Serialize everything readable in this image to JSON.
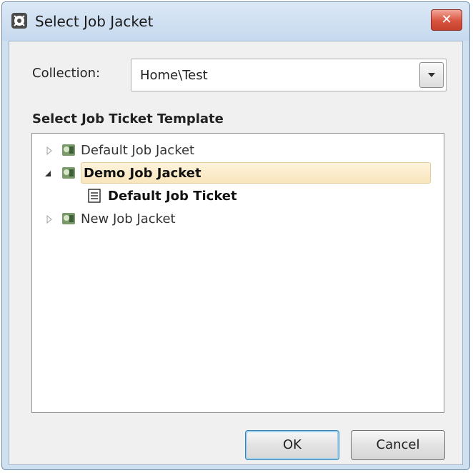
{
  "window": {
    "title": "Select Job Jacket",
    "close_label": "✕"
  },
  "collection": {
    "label": "Collection:",
    "value": "Home\\Test"
  },
  "template_section": {
    "heading": "Select Job Ticket Template"
  },
  "tree": {
    "items": [
      {
        "label": "Default Job Jacket",
        "expanded": false,
        "selected": false,
        "icon": "job-jacket-icon"
      },
      {
        "label": "Demo Job Jacket",
        "expanded": true,
        "selected": true,
        "icon": "job-jacket-icon"
      },
      {
        "label": "Default Job Ticket",
        "expanded": false,
        "selected": false,
        "icon": "job-ticket-icon"
      },
      {
        "label": "New Job Jacket",
        "expanded": false,
        "selected": false,
        "icon": "job-jacket-icon"
      }
    ]
  },
  "buttons": {
    "ok": "OK",
    "cancel": "Cancel"
  },
  "colors": {
    "titlebar": "#c6d9ee",
    "selection": "#f8e5bb",
    "close": "#d8543f",
    "default_button_glow": "#9ed4f2"
  }
}
